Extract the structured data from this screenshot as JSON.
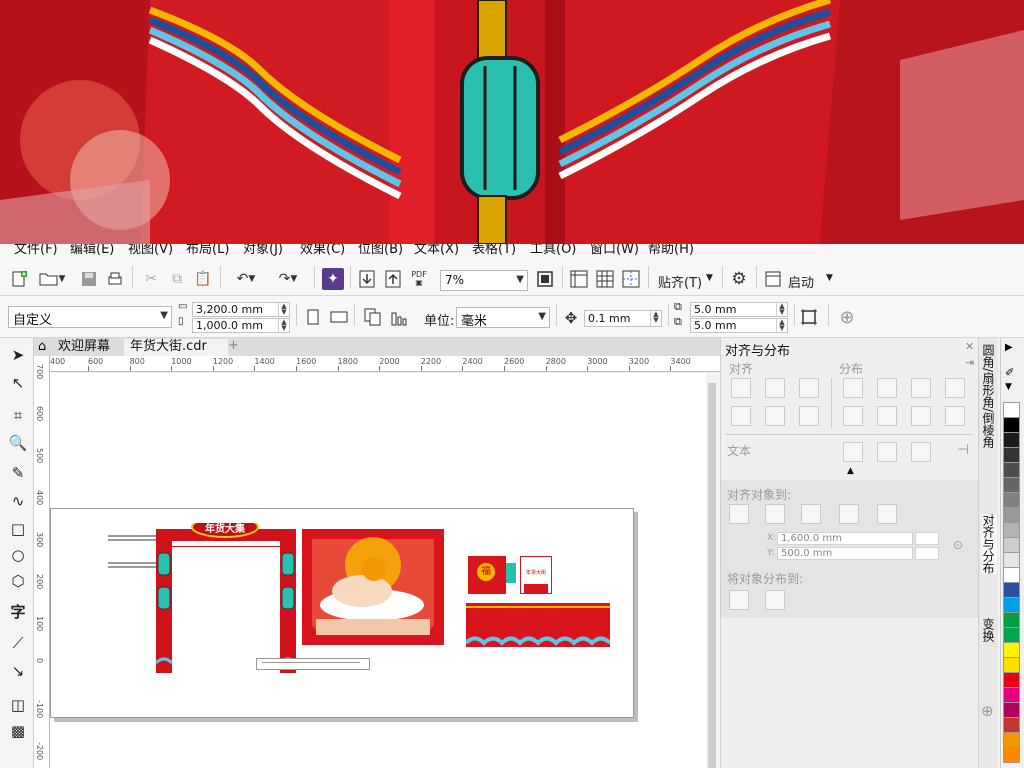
{
  "menu": {
    "items": [
      "文件(F)",
      "编辑(E)",
      "视图(V)",
      "布局(L)",
      "对象(J)",
      "效果(C)",
      "位图(B)",
      "文本(X)",
      "表格(T)",
      "工具(O)",
      "窗口(W)",
      "帮助(H)"
    ]
  },
  "standard_toolbar": {
    "zoom_value": "7%",
    "snap_label": "贴齐(T)",
    "launch_label": "启动",
    "pdf_label": "PDF"
  },
  "property_bar": {
    "page_size_preset": "自定义",
    "page_width": "3,200.0 mm",
    "page_height": "1,000.0 mm",
    "units_label": "单位:",
    "units_value": "毫米",
    "nudge_value": "0.1 mm",
    "dup_x": "5.0 mm",
    "dup_y": "5.0 mm"
  },
  "document_tabs": [
    {
      "label": "欢迎屏幕"
    },
    {
      "label": "年货大街.cdr"
    }
  ],
  "ruler": {
    "h_ticks": [
      "600",
      "800",
      "1000",
      "1200",
      "1400",
      "1600",
      "1800",
      "2000",
      "2200",
      "2400",
      "2600",
      "2800",
      "3000",
      "3200",
      "3400"
    ],
    "h_ticks_first": "400",
    "v_ticks": [
      "700",
      "600",
      "500",
      "400",
      "300",
      "200",
      "100",
      "0",
      "-100",
      "-200"
    ]
  },
  "canvas": {
    "arch_sign_text": "年货大集",
    "counter_sign_text": "年货大街",
    "fu_char": "福"
  },
  "docker": {
    "title": "对齐与分布",
    "align_section": "对齐",
    "distribute_section": "分布",
    "text_section": "文本",
    "align_to_section": "对齐对象到:",
    "x_value": "1,600.0 mm",
    "y_value": "500.0 mm",
    "x_label": "X:",
    "y_label": "Y:",
    "distribute_to_section": "将对象分布到:"
  },
  "side_tabs": [
    {
      "label": "圆角/扇形角/倒棱角"
    },
    {
      "label": "对齐与分布"
    },
    {
      "label": "变换"
    }
  ],
  "colors": {
    "accent_red": "#c8161e",
    "palette": [
      "#ffffff",
      "#000000",
      "#1a1a1a",
      "#333333",
      "#4d4d4d",
      "#666666",
      "#808080",
      "#999999",
      "#b3b3b3",
      "#cccccc",
      "#e6e6e6",
      "#ffffff",
      "#2d4fa0",
      "#00a0e9",
      "#0a9a46",
      "#00a651",
      "#fff200",
      "#ffde00",
      "#e60012",
      "#e4007f",
      "#b5005b",
      "#c0392b",
      "#f39800",
      "#ff8800"
    ]
  }
}
